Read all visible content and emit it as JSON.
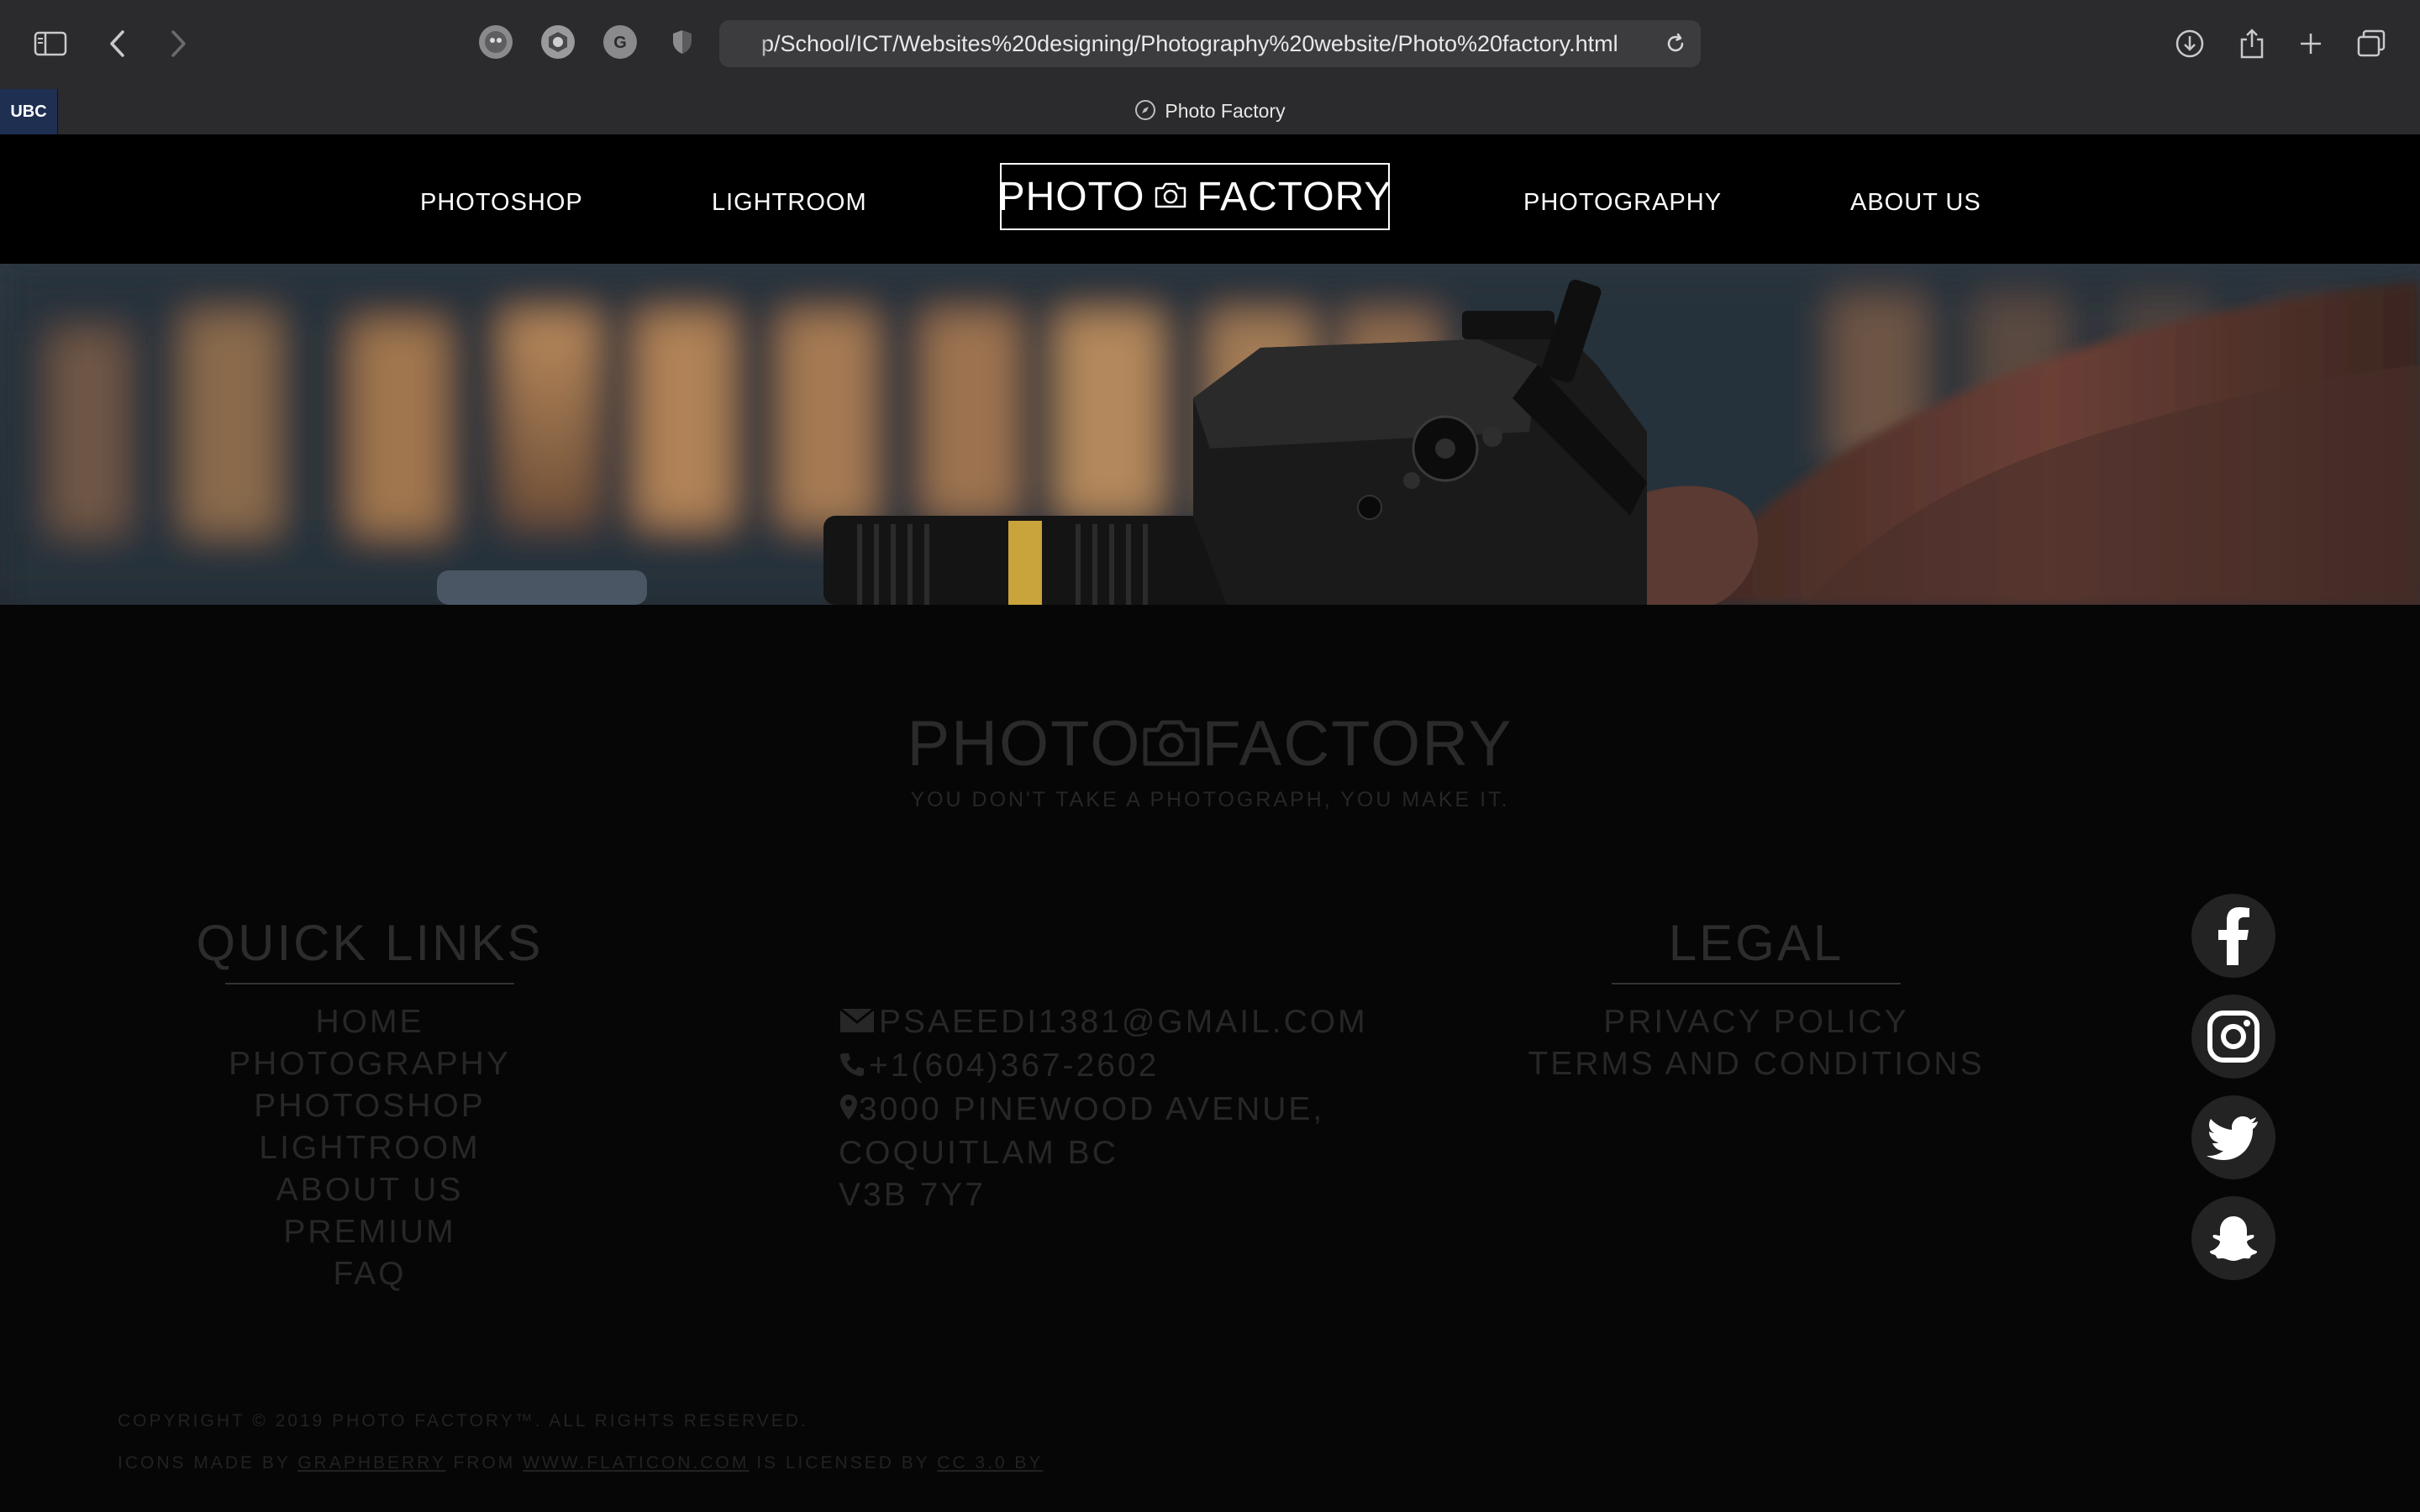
{
  "browser": {
    "url": "p/School/ICT/Websites%20designing/Photography%20website/Photo%20factory.html",
    "tab_title": "Photo Factory",
    "pinned_tab": "UBC"
  },
  "nav": {
    "left_links": [
      "PHOTOSHOP",
      "LIGHTROOM"
    ],
    "right_links": [
      "PHOTOGRAPHY",
      "ABOUT US"
    ],
    "logo_left": "PHOTO",
    "logo_right": "FACTORY"
  },
  "footer": {
    "brand_left": "PHOTO",
    "brand_right": "FACTORY",
    "tagline": "YOU DON'T TAKE A PHOTOGRAPH, YOU MAKE IT.",
    "quick_links": {
      "heading": "QUICK LINKS",
      "items": [
        "HOME",
        "PHOTOGRAPHY",
        "PHOTOSHOP",
        "LIGHTROOM",
        "ABOUT US",
        "PREMIUM",
        "FAQ"
      ]
    },
    "contact": {
      "email": "PSAEEDI1381@GMAIL.COM",
      "phone": "+1(604)367-2602",
      "address_line1": "3000 PINEWOOD AVENUE,",
      "address_line2": "COQUITLAM BC",
      "address_line3": "V3B 7Y7"
    },
    "legal": {
      "heading": "LEGAL",
      "items": [
        "PRIVACY POLICY",
        "TERMS AND CONDITIONS"
      ]
    },
    "social": [
      "facebook-icon",
      "instagram-icon",
      "twitter-icon",
      "snapchat-icon"
    ],
    "copyright": "COPYRIGHT © 2019 PHOTO FACTORY™. ALL RIGHTS RESERVED.",
    "credit": {
      "prefix": "ICONS MADE BY ",
      "author": "GRAPHBERRY",
      "mid": " FROM ",
      "site": "WWW.FLATICON.COM",
      "mid2": " IS LICENSED BY ",
      "license": "CC 3.0 BY"
    }
  }
}
